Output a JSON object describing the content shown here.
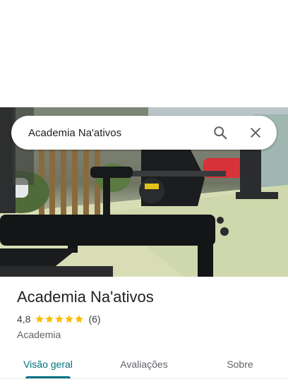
{
  "search": {
    "query": "Academia Na'ativos"
  },
  "place": {
    "title": "Academia Na'ativos",
    "rating": "4,8",
    "stars": 5,
    "review_count": "(6)",
    "category": "Academia"
  },
  "tabs": [
    {
      "label": "Visão geral",
      "active": true
    },
    {
      "label": "Avaliações",
      "active": false
    },
    {
      "label": "Sobre",
      "active": false
    }
  ],
  "colors": {
    "accent": "#00717f",
    "star": "#fbbc04"
  },
  "icons": {
    "search": "search-icon",
    "close": "close-icon",
    "star": "star-icon"
  }
}
